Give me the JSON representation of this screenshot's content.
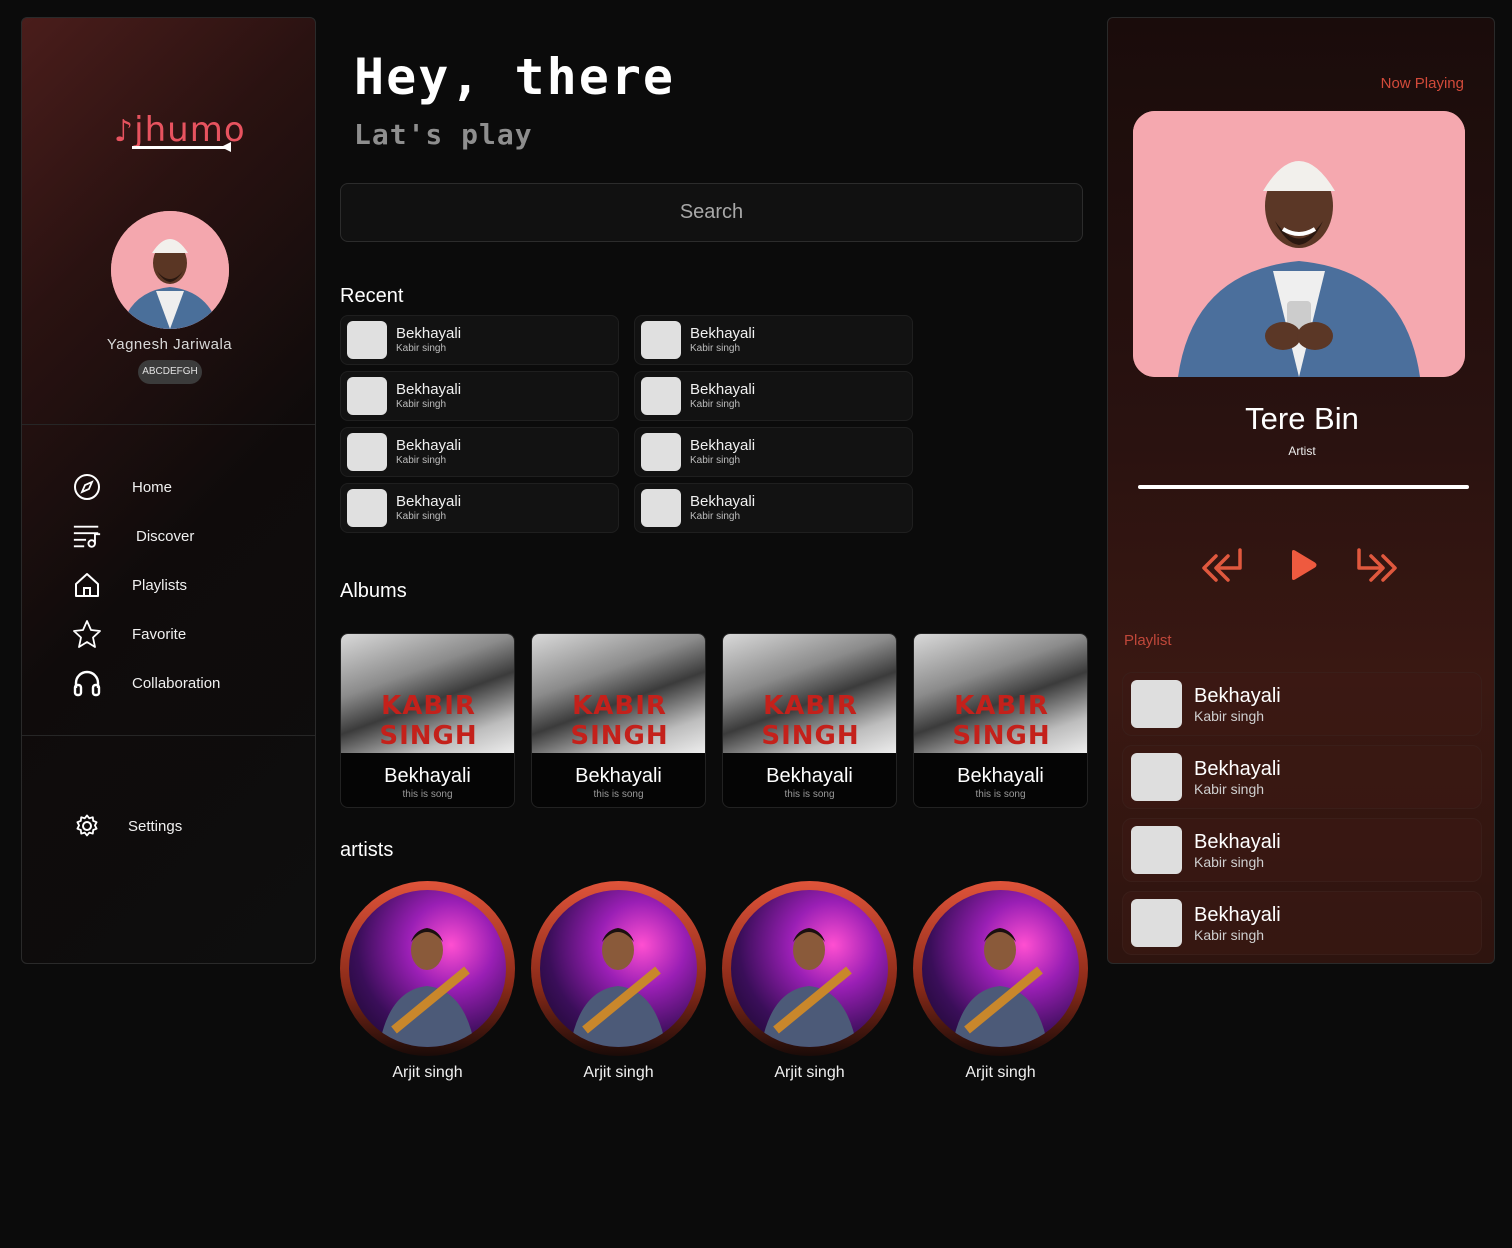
{
  "app": {
    "logo": "jhumo"
  },
  "sidebar": {
    "user_name": "Yagnesh Jariwala",
    "user_badge": "ABCDEFGH",
    "nav": [
      {
        "label": "Home",
        "icon": "compass-icon"
      },
      {
        "label": "Discover",
        "icon": "playlist-music-icon"
      },
      {
        "label": "Playlists",
        "icon": "home-icon"
      },
      {
        "label": "Favorite",
        "icon": "star-icon"
      },
      {
        "label": "Collaboration",
        "icon": "headphones-icon"
      }
    ],
    "settings_label": "Settings"
  },
  "header": {
    "greeting": "Hey, there",
    "subtitle": "Lat's play"
  },
  "search": {
    "placeholder": "Search"
  },
  "recent": {
    "title": "Recent",
    "items": [
      {
        "title": "Bekhayali",
        "artist": "Kabir singh"
      },
      {
        "title": "Bekhayali",
        "artist": "Kabir singh"
      },
      {
        "title": "Bekhayali",
        "artist": "Kabir singh"
      },
      {
        "title": "Bekhayali",
        "artist": "Kabir singh"
      },
      {
        "title": "Bekhayali",
        "artist": "Kabir singh"
      },
      {
        "title": "Bekhayali",
        "artist": "Kabir singh"
      },
      {
        "title": "Bekhayali",
        "artist": "Kabir singh"
      },
      {
        "title": "Bekhayali",
        "artist": "Kabir singh"
      }
    ]
  },
  "albums": {
    "title": "Albums",
    "cover_text": "KABIR SINGH",
    "items": [
      {
        "title": "Bekhayali",
        "subtitle": "this is song"
      },
      {
        "title": "Bekhayali",
        "subtitle": "this is song"
      },
      {
        "title": "Bekhayali",
        "subtitle": "this is song"
      },
      {
        "title": "Bekhayali",
        "subtitle": "this is song"
      }
    ]
  },
  "artists": {
    "title": "artists",
    "items": [
      {
        "name": "Arjit singh"
      },
      {
        "name": "Arjit singh"
      },
      {
        "name": "Arjit singh"
      },
      {
        "name": "Arjit singh"
      }
    ]
  },
  "player": {
    "now_playing_label": "Now Playing",
    "song_title": "Tere Bin",
    "song_artist": "Artist",
    "progress": 1.0,
    "playlist_label": "Playlist",
    "playlist": [
      {
        "title": "Bekhayali",
        "artist": "Kabir singh"
      },
      {
        "title": "Bekhayali",
        "artist": "Kabir singh"
      },
      {
        "title": "Bekhayali",
        "artist": "Kabir singh"
      },
      {
        "title": "Bekhayali",
        "artist": "Kabir singh"
      }
    ]
  },
  "colors": {
    "accent": "#e7535f",
    "control": "#e0583e",
    "background": "#0b0b0b"
  }
}
